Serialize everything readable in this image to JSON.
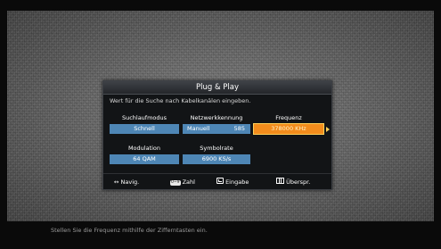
{
  "dialog": {
    "title": "Plug & Play",
    "instruction": "Wert für die Suche nach Kabelkanälen eingeben."
  },
  "fields": {
    "suchlaufmodus": {
      "label": "Suchlaufmodus",
      "value": "Schnell"
    },
    "netzwerkkennung": {
      "label": "Netzwerkkennung",
      "mode": "Manuell",
      "value": "585"
    },
    "frequenz": {
      "label": "Frequenz",
      "value": "378000 KHz",
      "selected": true
    },
    "modulation": {
      "label": "Modulation",
      "value": "64 QAM"
    },
    "symbolrate": {
      "label": "Symbolrate",
      "value": "6900 KS/s"
    }
  },
  "legend": {
    "navig_icon": "↔",
    "navig": "Navig.",
    "zahl_key": "0~9",
    "zahl": "Zahl",
    "eingabe_icon": "enter-icon",
    "eingabe": "Eingabe",
    "ueberspr_icon": "skip-icon",
    "ueberspr": "Überspr."
  },
  "help_text": "Stellen Sie die Frequenz mithilfe der Zifferntasten ein.",
  "colors": {
    "field_blue": "#4e86b5",
    "selected_orange": "#f28c1c",
    "dialog_bg": "#121416"
  }
}
